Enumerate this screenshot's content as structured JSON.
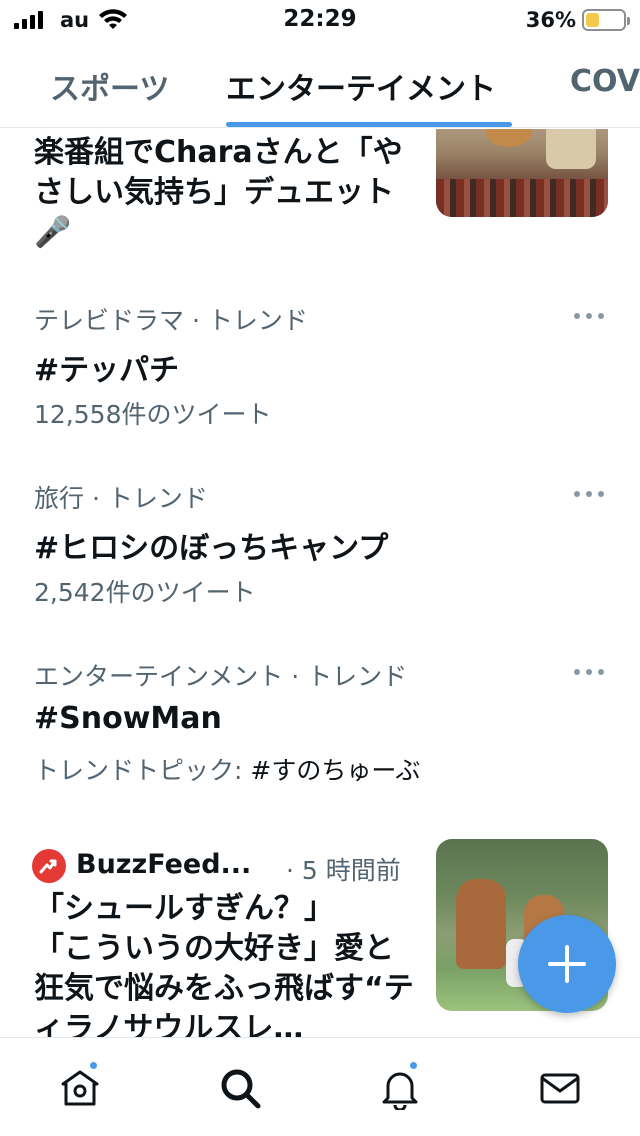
{
  "status_bar": {
    "carrier": "au",
    "time": "22:29",
    "battery_percent": "36%",
    "battery_level": 0.36,
    "battery_color": "#f2c94c"
  },
  "tabs": [
    {
      "label": "スポーツ",
      "active": false
    },
    {
      "label": "エンターテイメント",
      "active": true
    },
    {
      "label": "COV",
      "active": false
    }
  ],
  "accent_color": "#4a99e9",
  "story_top": {
    "headline": "楽番組でCharaさんと「やさしい気持ち」デュエット🎤",
    "thumbnail_icon": "concert-photo"
  },
  "trends": [
    {
      "meta": "テレビドラマ · トレンド",
      "name": "#テッパチ",
      "count": "12,558件のツイート"
    },
    {
      "meta": "旅行 · トレンド",
      "name": "#ヒロシのぼっちキャンプ",
      "count": "2,542件のツイート"
    },
    {
      "meta": "エンターテインメント · トレンド",
      "name": "#SnowMan",
      "count_prefix": "トレンドトピック: ",
      "count_topic": "#すのちゅーぶ"
    }
  ],
  "news": {
    "source": "BuzzFeed...",
    "time": "· 5 時間前",
    "headline": "「シュールすぎん？」\n「こういうの大好き」愛と狂気で悩みをふっ飛ばす“ティラノサウルスレ…",
    "thumbnail_icon": "dinosaur-costume-photo"
  },
  "bottom_nav": [
    {
      "icon": "home-icon",
      "badge": true
    },
    {
      "icon": "search-icon",
      "badge": false,
      "active": true
    },
    {
      "icon": "bell-icon",
      "badge": true
    },
    {
      "icon": "mail-icon",
      "badge": false
    }
  ]
}
